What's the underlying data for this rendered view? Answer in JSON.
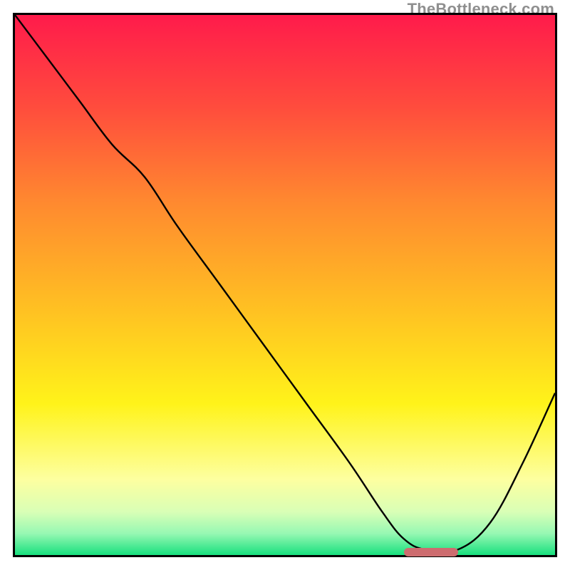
{
  "watermark": "TheBottleneck.com",
  "chart_data": {
    "type": "line",
    "title": "",
    "xlabel": "",
    "ylabel": "",
    "x_range": [
      0,
      100
    ],
    "y_range": [
      0,
      100
    ],
    "grid": false,
    "legend": false,
    "gradient_stops": [
      {
        "offset": 0.0,
        "color": "#ff1b4b"
      },
      {
        "offset": 0.17,
        "color": "#ff4c3d"
      },
      {
        "offset": 0.35,
        "color": "#ff8a2f"
      },
      {
        "offset": 0.55,
        "color": "#ffc222"
      },
      {
        "offset": 0.72,
        "color": "#fff31a"
      },
      {
        "offset": 0.86,
        "color": "#fdffa0"
      },
      {
        "offset": 0.92,
        "color": "#d9ffb6"
      },
      {
        "offset": 0.96,
        "color": "#97f8b3"
      },
      {
        "offset": 1.0,
        "color": "#18e07e"
      }
    ],
    "series": [
      {
        "name": "bottleneck-curve",
        "x": [
          0,
          6,
          12,
          18,
          24,
          30,
          38,
          46,
          54,
          62,
          68,
          72,
          76,
          82,
          88,
          94,
          100
        ],
        "y": [
          100,
          92,
          84,
          76,
          70,
          61,
          50,
          39,
          28,
          17,
          8,
          3,
          1,
          1,
          6,
          17,
          30
        ]
      }
    ],
    "marker": {
      "name": "optimal-range",
      "x_start": 72,
      "x_end": 82,
      "y": 0.5,
      "color": "#cd6c6f"
    }
  }
}
